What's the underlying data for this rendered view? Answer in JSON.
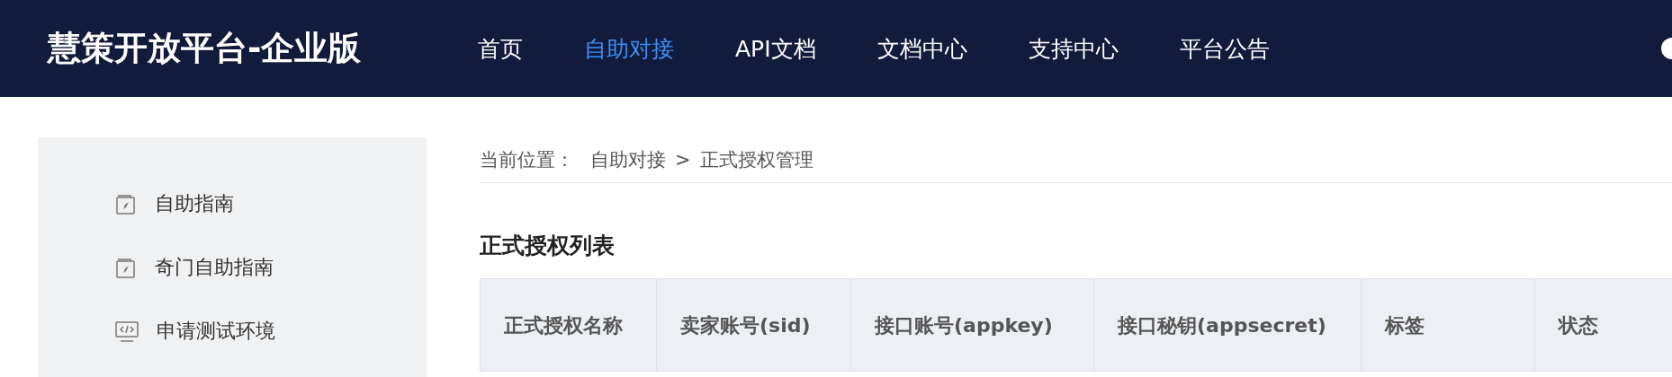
{
  "header": {
    "logo": "慧策开放平台-企业版",
    "nav": [
      {
        "label": "首页",
        "selected": false
      },
      {
        "label": "自助对接",
        "selected": true
      },
      {
        "label": "API文档",
        "selected": false
      },
      {
        "label": "文档中心",
        "selected": false
      },
      {
        "label": "支持中心",
        "selected": false
      },
      {
        "label": "平台公告",
        "selected": false
      }
    ]
  },
  "sidebar": {
    "items": [
      {
        "label": "自助指南",
        "kind": "guide"
      },
      {
        "label": "奇门自助指南",
        "kind": "guide"
      },
      {
        "label": "申请测试环境",
        "kind": "code"
      }
    ]
  },
  "breadcrumb": {
    "prefix": "当前位置：",
    "items": [
      "自助对接",
      "正式授权管理"
    ],
    "separator": ">"
  },
  "section_title": "正式授权列表",
  "table": {
    "columns": [
      "正式授权名称",
      "卖家账号(sid)",
      "接口账号(appkey)",
      "接口秘钥(appsecret)",
      "标签",
      "状态"
    ]
  }
}
